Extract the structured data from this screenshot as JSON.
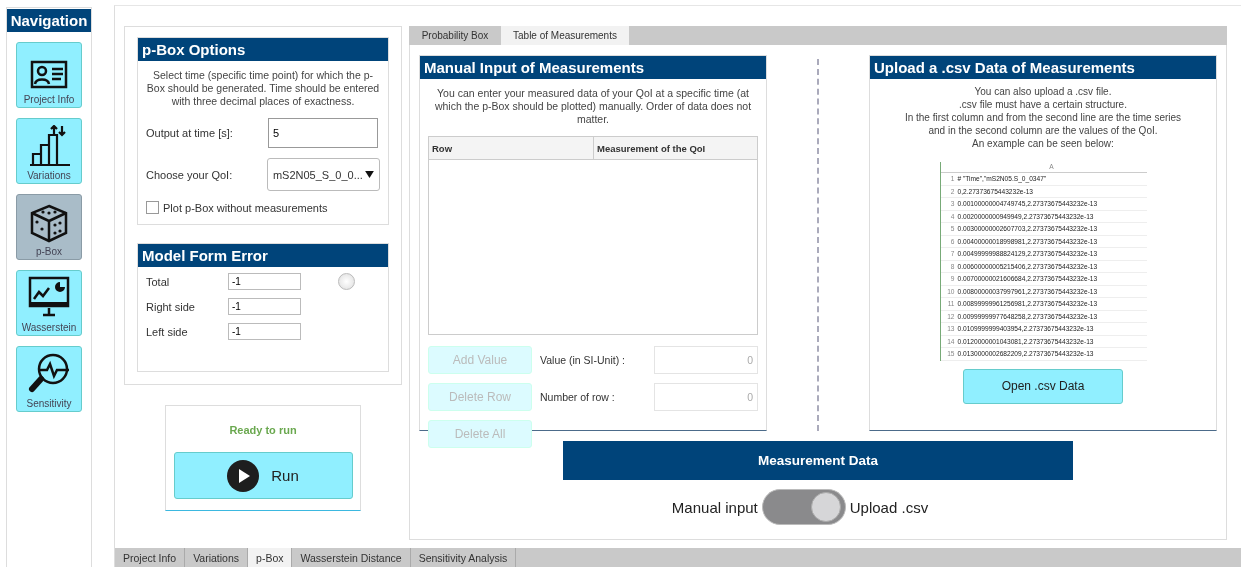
{
  "navigation": {
    "title": "Navigation",
    "items": [
      {
        "label": "Project Info",
        "kind": "card",
        "selected": false
      },
      {
        "label": "Variations",
        "kind": "bars",
        "selected": false
      },
      {
        "label": "p-Box",
        "kind": "dice",
        "selected": true
      },
      {
        "label": "Wasserstein",
        "kind": "monitor",
        "selected": false
      },
      {
        "label": "Sensitivity",
        "kind": "magnifier",
        "selected": false
      }
    ]
  },
  "pbox_options": {
    "title": "p-Box Options",
    "description": "Select time (specific time point) for which the p-Box should be generated. Time should be entered with three decimal places of exactness.",
    "output_label": "Output at time [s]:",
    "output_value": "5",
    "qoi_label": "Choose your QoI:",
    "qoi_value": "mS2N05_S_0_0...",
    "plot_checkbox": {
      "label": "Plot p-Box without measurements",
      "checked": false
    }
  },
  "model_form_error": {
    "title": "Model Form Error",
    "rows": [
      {
        "label": "Total",
        "value": "-1",
        "kind": "radio",
        "selected": false
      },
      {
        "label": "Right side",
        "value": "-1",
        "kind": "plain"
      },
      {
        "label": "Left side",
        "value": "-1",
        "kind": "plain"
      }
    ]
  },
  "run_card": {
    "status": "Ready to run",
    "button": "Run"
  },
  "tabs": [
    {
      "label": "Probability Box",
      "selected": false
    },
    {
      "label": "Table of Measurements",
      "selected": true
    }
  ],
  "manual_input": {
    "title": "Manual Input of Measurements",
    "description": "You can enter your measured data of your QoI at a specific time (at which the p-Box should be plotted) manually. Order of data does not matter.",
    "columns": [
      "Row",
      "Measurement of the QoI"
    ],
    "controls": [
      {
        "button": "Add Value",
        "disabled": true,
        "label": "Value (in SI-Unit) :",
        "value": "0"
      },
      {
        "button": "Delete Row",
        "disabled": true,
        "label": "Number of row :",
        "value": "0"
      },
      {
        "button": "Delete All",
        "disabled": true
      }
    ]
  },
  "upload_csv": {
    "title": "Upload a .csv Data of Measurements",
    "description_lines": [
      "You can also upload a .csv file.",
      ".csv file must have a certain structure.",
      "In the first column and from the second line are the time series",
      "and in the second column are the values of the QoI.",
      "An example can be seen below:"
    ],
    "example": {
      "column_header": "A",
      "rows": [
        {
          "num": "1",
          "text": "# \"Time\",\"mS2N05.S_0_0347\""
        },
        {
          "num": "2",
          "text": "0,2.27373675443232e-13"
        },
        {
          "num": "3",
          "text": "0.00100000004749745,2.27373675443232e-13"
        },
        {
          "num": "4",
          "text": "0.0020000000949949,2.27373675443232e-13"
        },
        {
          "num": "5",
          "text": "0.00300000002607703,2.27373675443232e-13"
        },
        {
          "num": "6",
          "text": "0.00400000018998981,2.27373675443232e-13"
        },
        {
          "num": "7",
          "text": "0.00499999988824129,2.27373675443232e-13"
        },
        {
          "num": "8",
          "text": "0.00600000005215406,2.27373675443232e-13"
        },
        {
          "num": "9",
          "text": "0.00700000021606684,2.27373675443232e-13"
        },
        {
          "num": "10",
          "text": "0.00800000037997961,2.27373675443232e-13"
        },
        {
          "num": "11",
          "text": "0.00899999961256981,2.27373675443232e-13"
        },
        {
          "num": "12",
          "text": "0.00999999977648258,2.27373675443232e-13"
        },
        {
          "num": "13",
          "text": "0.0109999999403954,2.27373675443232e-13"
        },
        {
          "num": "14",
          "text": "0.0120000001043081,2.27373675443232e-13"
        },
        {
          "num": "15",
          "text": "0.0130000002682209,2.27373675443232e-13"
        }
      ]
    },
    "button": "Open .csv Data"
  },
  "measurement_data": {
    "title": "Measurement Data",
    "left_label": "Manual input",
    "right_label": "Upload .csv",
    "on": true
  },
  "bottom_tabs": [
    {
      "label": "Project Info",
      "selected": false
    },
    {
      "label": "Variations",
      "selected": false
    },
    {
      "label": "p-Box",
      "selected": true
    },
    {
      "label": "Wasserstein Distance",
      "selected": false
    },
    {
      "label": "Sensitivity Analysis",
      "selected": false
    }
  ]
}
